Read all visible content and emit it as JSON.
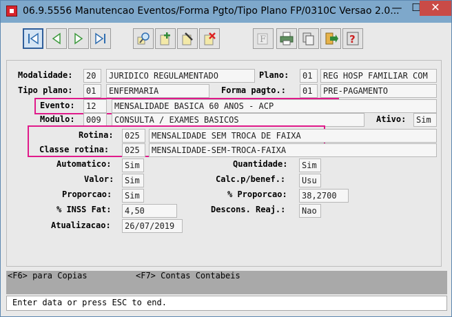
{
  "window": {
    "title": "06.9.5556 Manutencao  Eventos/Forma Pgto/Tipo Plano FP/0310C Versao 2.0...",
    "minimize_glyph": "—",
    "maximize_glyph": "☐",
    "close_glyph": "✕"
  },
  "toolbar": {
    "icons": [
      "first-record",
      "previous-record",
      "next-record",
      "last-record",
      "search",
      "add",
      "edit",
      "delete",
      "filter",
      "print",
      "copy",
      "exit",
      "help"
    ]
  },
  "form": {
    "modalidade": {
      "label": "Modalidade:",
      "code": "20",
      "desc": "JURIDICO REGULAMENTADO"
    },
    "plano": {
      "label": "Plano:",
      "code": "01",
      "desc": "REG HOSP FAMILIAR COM"
    },
    "tipo_plano": {
      "label": "Tipo plano:",
      "code": "01",
      "desc": "ENFERMARIA"
    },
    "forma_pagto": {
      "label": "Forma pagto.:",
      "code": "01",
      "desc": "PRE-PAGAMENTO"
    },
    "evento": {
      "label": "Evento:",
      "code": "12",
      "desc": "MENSALIDADE BASICA 60 ANOS - ACP"
    },
    "modulo": {
      "label": "Modulo:",
      "code": "009",
      "desc": "CONSULTA / EXAMES BASICOS"
    },
    "ativo": {
      "label": "Ativo:",
      "value": "Sim"
    },
    "rotina": {
      "label": "Rotina:",
      "code": "025",
      "desc": "MENSALIDADE SEM TROCA DE FAIXA"
    },
    "classe_rotina": {
      "label": "Classe rotina:",
      "code": "025",
      "desc": "MENSALIDADE-SEM-TROCA-FAIXA"
    },
    "automatico": {
      "label": "Automatico:",
      "value": "Sim"
    },
    "quantidade": {
      "label": "Quantidade:",
      "value": "Sim"
    },
    "valor": {
      "label": "Valor:",
      "value": "Sim"
    },
    "calc_benef": {
      "label": "Calc.p/benef.:",
      "value": "Usu"
    },
    "proporcao": {
      "label": "Proporcao:",
      "value": "Sim"
    },
    "pct_proporcao": {
      "label": "% Proporcao:",
      "value": "38,2700"
    },
    "pct_inss": {
      "label": "% INSS Fat:",
      "value": "4,50"
    },
    "descons_reaj": {
      "label": "Descons. Reaj.:",
      "value": "Nao"
    },
    "atualizacao": {
      "label": "Atualizacao:",
      "value": "26/07/2019"
    }
  },
  "function_keys": {
    "f6": "<F6> para Copias",
    "f7": "<F7> Contas Contabeis"
  },
  "status_bar": {
    "message": "Enter data or press ESC to end."
  },
  "colors": {
    "highlight": "#e0198a",
    "titlebar": "#7ea8cb",
    "close": "#c94b47"
  }
}
